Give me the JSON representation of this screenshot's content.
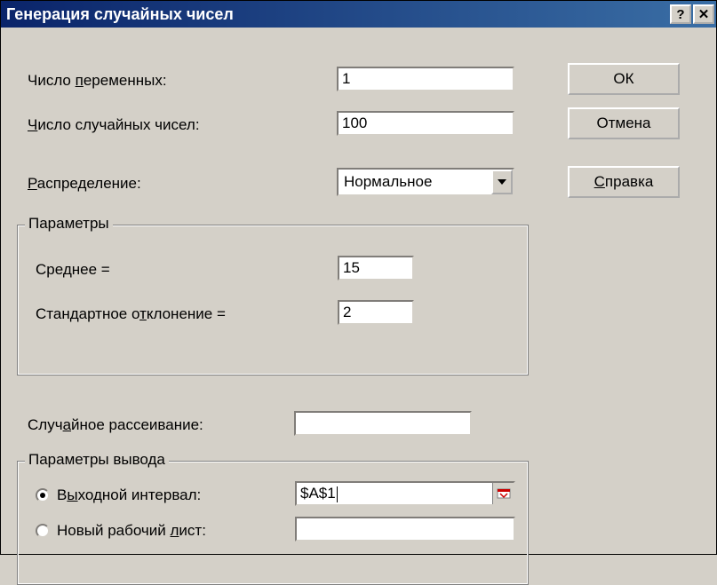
{
  "window": {
    "title": "Генерация случайных чисел"
  },
  "buttons": {
    "ok": "ОК",
    "cancel": "Отмена",
    "help": "Справка"
  },
  "fields": {
    "num_vars_label": "Число переменных:",
    "num_vars_value": "1",
    "num_rand_label": "Число случайных чисел:",
    "num_rand_value": "100",
    "distribution_label": "Распределение:",
    "distribution_value": "Нормальное"
  },
  "params": {
    "legend": "Параметры",
    "mean_label": "Среднее =",
    "mean_value": "15",
    "stddev_label": "Стандартное отклонение =",
    "stddev_value": "2"
  },
  "seed": {
    "label": "Случайное рассеивание:",
    "value": ""
  },
  "output": {
    "legend": "Параметры вывода",
    "out_range_label": "Выходной интервал:",
    "out_range_value": "$A$1",
    "new_sheet_label": "Новый рабочий лист:",
    "new_sheet_value": ""
  },
  "hotkeys": {
    "num_vars": "п",
    "num_rand": "Ч",
    "distribution": "Р",
    "stddev": "т",
    "seed": "а",
    "help": "С",
    "out_range": "ы",
    "new_sheet": "л"
  }
}
